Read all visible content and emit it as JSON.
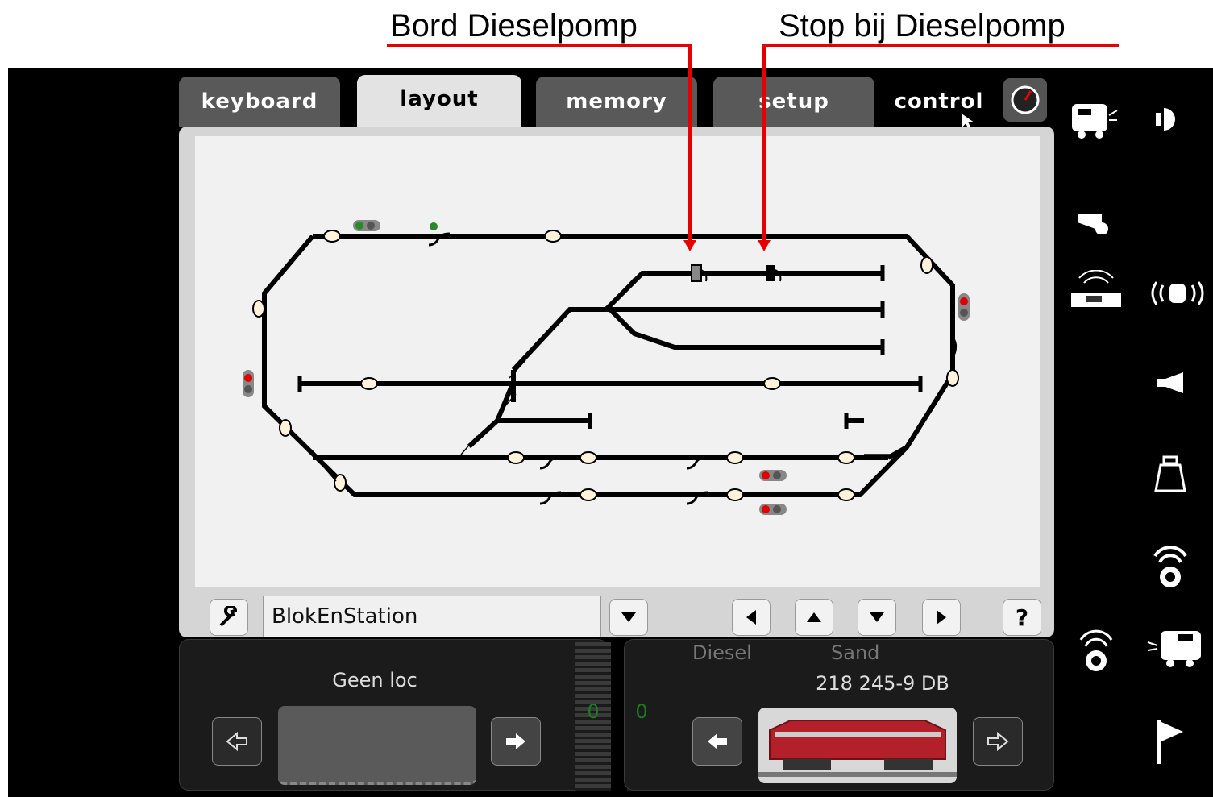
{
  "annotations": {
    "left_label": "Bord Dieselpomp",
    "right_label": "Stop bij Dieselpomp",
    "color": "#e60000"
  },
  "tabs": [
    {
      "label": "keyboard"
    },
    {
      "label": "layout",
      "active": true
    },
    {
      "label": "memory"
    },
    {
      "label": "setup"
    },
    {
      "label": "control"
    }
  ],
  "toolbar": {
    "layout_name": "BlokEnStation",
    "help_label": "?"
  },
  "cab_left": {
    "loco_name": "Geen loc",
    "speed": "0"
  },
  "cab_right": {
    "function_1": "Diesel",
    "function_2": "Sand",
    "loco_name": "218 245-9 DB",
    "speed": "0"
  },
  "icons": {
    "clock": "gauge-icon",
    "wrench": "wrench-icon",
    "sidebar": [
      "loco-light-icon",
      "headlight-icon",
      "whistle-icon",
      "radio-loco-icon",
      "radio-train-icon",
      "horn-icon",
      "weight-icon",
      "sound-icon",
      "sound-icon-2",
      "loco-sound-icon",
      "flag-icon"
    ]
  },
  "colors": {
    "track": "#000000",
    "signal_red": "#e00000",
    "signal_green": "#2a8a2a",
    "loco_red": "#b3202a"
  }
}
